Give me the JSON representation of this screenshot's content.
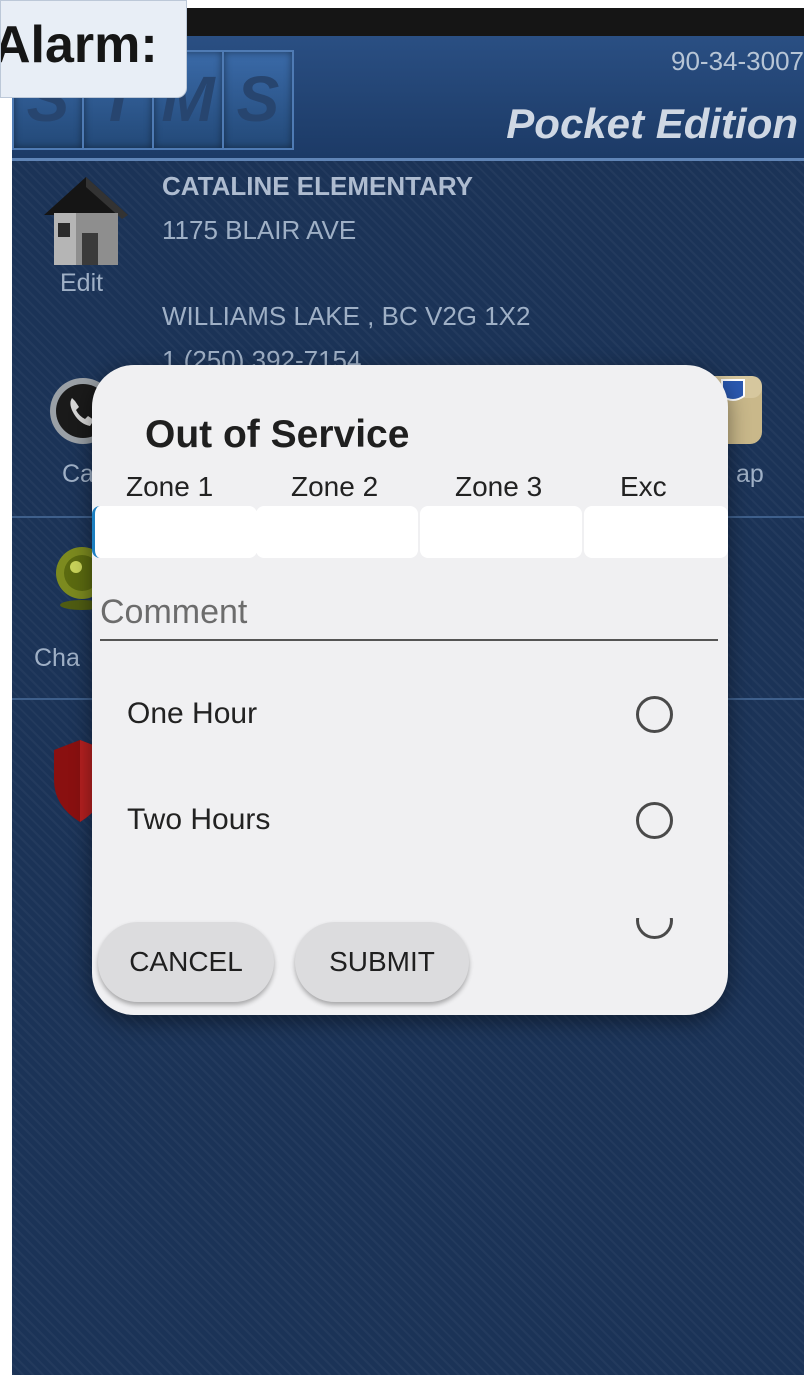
{
  "header": {
    "logo_letters": [
      "S",
      "T",
      "M",
      "S"
    ],
    "account_number": "90-34-3007",
    "edition": "Pocket Edition"
  },
  "overlay_tag": {
    "text": "Alarm:"
  },
  "site": {
    "name": "CATALINE ELEMENTARY",
    "address_line1": "1175 BLAIR AVE",
    "city_line": "WILLIAMS LAKE , BC V2G 1X2",
    "phone": "1 (250) 392-7154",
    "edit_label": "Edit"
  },
  "side_menu": {
    "call_label": "Ca",
    "change_label": "Cha",
    "map_label": "ap"
  },
  "dialog": {
    "title": "Out of Service",
    "zones": [
      "Zone 1",
      "Zone 2",
      "Zone 3",
      "Exc"
    ],
    "zone_values": [
      "",
      "",
      "",
      ""
    ],
    "comment_placeholder": "Comment",
    "comment_value": "",
    "options": [
      {
        "label": "One Hour",
        "selected": false
      },
      {
        "label": "Two Hours",
        "selected": false
      }
    ],
    "cancel_label": "CANCEL",
    "submit_label": "SUBMIT"
  },
  "colors": {
    "app_background": "#1b3357",
    "header_background": "#2a4f83",
    "dialog_background": "#f0f0f2",
    "button_background": "#dcdcde"
  }
}
